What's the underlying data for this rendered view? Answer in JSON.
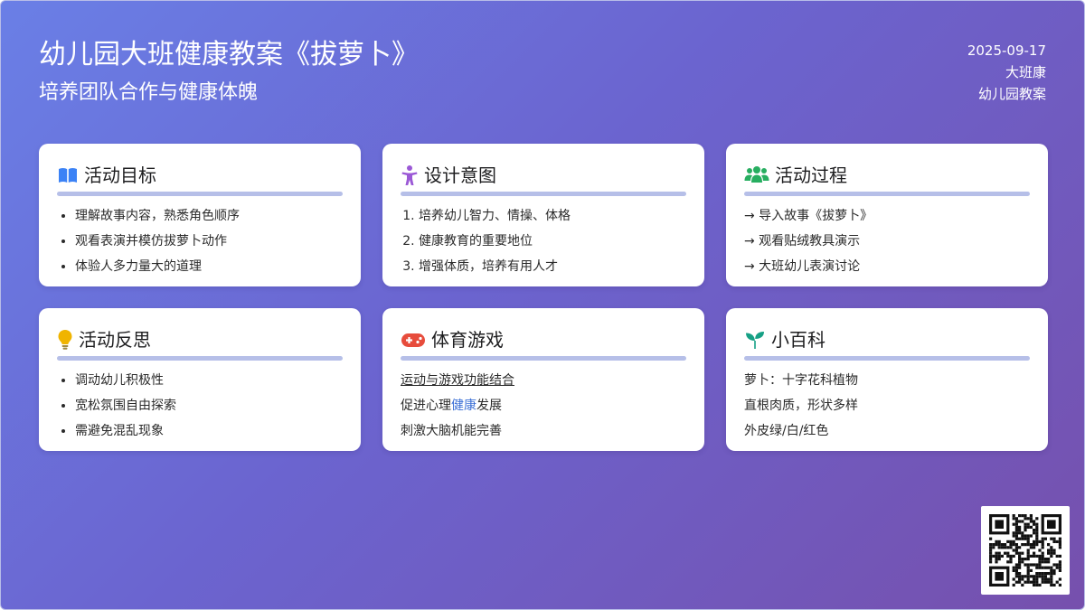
{
  "header": {
    "title": "幼儿园大班健康教案《拔萝卜》",
    "subtitle": "培养团队合作与健康体魄"
  },
  "meta": {
    "date": "2025-09-17",
    "category": "大班康",
    "type": "幼儿园教案"
  },
  "cards": {
    "goals": {
      "title": "活动目标",
      "icon": "book-icon",
      "items": [
        "理解故事内容，熟悉角色顺序",
        "观看表演并模仿拔萝卜动作",
        "体验人多力量大的道理"
      ]
    },
    "design": {
      "title": "设计意图",
      "icon": "child-icon",
      "items": [
        "培养幼儿智力、情操、体格",
        "健康教育的重要地位",
        "增强体质，培养有用人才"
      ]
    },
    "process": {
      "title": "活动过程",
      "icon": "users-icon",
      "items": [
        "→ 导入故事《拔萝卜》",
        "→ 观看贴绒教具演示",
        "→ 大班幼儿表演讨论"
      ]
    },
    "reflection": {
      "title": "活动反思",
      "icon": "lightbulb-icon",
      "items": [
        "调动幼儿积极性",
        "宽松氛围自由探索",
        "需避免混乱现象"
      ]
    },
    "pe": {
      "title": "体育游戏",
      "icon": "gamepad-icon",
      "line1": "运动与游戏功能结合",
      "line2_prefix": "促进心理",
      "line2_accent": "健康",
      "line2_suffix": "发展",
      "line3": "刺激大脑机能完善"
    },
    "wiki": {
      "title": "小百科",
      "icon": "sprout-icon",
      "items": [
        "萝卜：十字花科植物",
        "直根肉质，形状多样",
        "外皮绿/白/红色"
      ]
    }
  },
  "colors": {
    "gradient_start": "#6a7fe6",
    "gradient_end": "#7650ad",
    "rule": "#b6bfe8",
    "book": "#3b82f6",
    "child": "#9b59d6",
    "users": "#27ae60",
    "bulb": "#f0b400",
    "gamepad": "#e74c3c",
    "sprout": "#16a085"
  },
  "qr": {
    "icon": "qr-code-icon"
  }
}
